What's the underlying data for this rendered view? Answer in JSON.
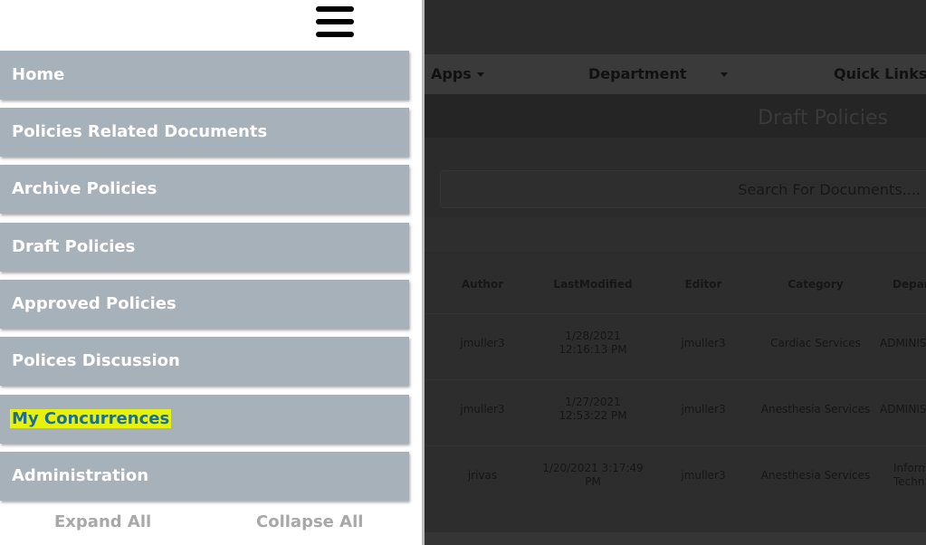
{
  "side_menu": {
    "items": [
      {
        "label": "Home"
      },
      {
        "label": "Policies Related Documents"
      },
      {
        "label": "Archive Policies"
      },
      {
        "label": "Draft Policies"
      },
      {
        "label": "Approved Policies"
      },
      {
        "label": "Polices Discussion"
      },
      {
        "label": "My Concurrences",
        "highlighted": true
      },
      {
        "label": "Administration"
      }
    ],
    "expand_all": "Expand All",
    "collapse_all": "Collapse All",
    "highlight_color": "#e6f20a"
  },
  "nav": {
    "apps": "Apps",
    "department": "Department",
    "quick_links": "Quick Links"
  },
  "page": {
    "title": "Draft Policies",
    "search_placeholder": "Search For Documents...."
  },
  "table": {
    "columns": [
      "Author",
      "LastModified",
      "Editor",
      "Category",
      "Depar"
    ],
    "rows": [
      {
        "author": "jmuller3",
        "modified_l1": "1/28/2021",
        "modified_l2": "12:16:13 PM",
        "editor": "jmuller3",
        "category": "Cardiac Services",
        "dept_l1": "ADMINIS",
        "dept_l2": ""
      },
      {
        "author": "jmuller3",
        "modified_l1": "1/27/2021",
        "modified_l2": "12:53:22 PM",
        "editor": "jmuller3",
        "category": "Anesthesia Services",
        "dept_l1": "ADMINIS",
        "dept_l2": ""
      },
      {
        "author": "jrivas",
        "modified_l1": "1/20/2021 3:17:49",
        "modified_l2": "PM",
        "editor": "jmuller3",
        "category": "Anesthesia Services",
        "dept_l1": "Inform",
        "dept_l2": "Techn"
      }
    ]
  },
  "colors": {
    "menu_item_bg": "#a7b1ba",
    "overlay_bg": "#2b2b2b"
  }
}
